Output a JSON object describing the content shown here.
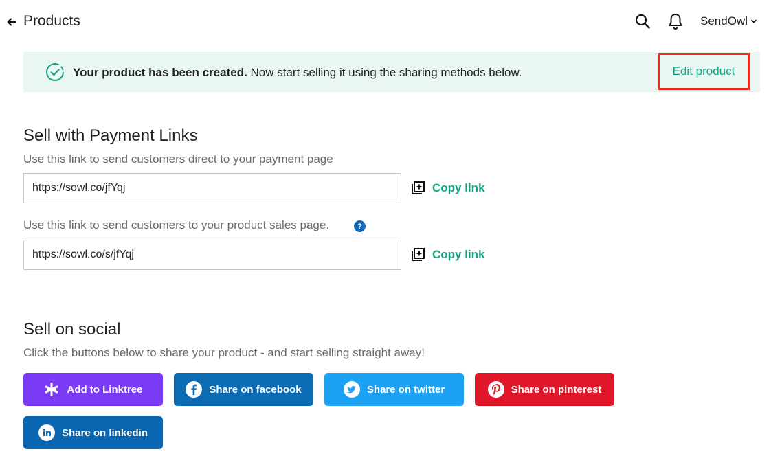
{
  "header": {
    "title": "Products",
    "account_name": "SendOwl"
  },
  "banner": {
    "bold_text": "Your product has been created.",
    "text": " Now start selling it using the sharing methods below.",
    "edit_label": "Edit product"
  },
  "payment_links": {
    "heading": "Sell with Payment Links",
    "direct_description": "Use this link to send customers direct to your payment page",
    "direct_url": "https://sowl.co/jfYqj",
    "sales_description": "Use this link to send customers to your product sales page.",
    "sales_url": "https://sowl.co/s/jfYqj",
    "copy_label": "Copy link",
    "help_glyph": "?"
  },
  "social": {
    "heading": "Sell on social",
    "description": "Click the buttons below to share your product - and start selling straight away!",
    "buttons": [
      {
        "label": "Add to Linktree",
        "icon": "linktree-icon",
        "color": "#7b3bf5"
      },
      {
        "label": "Share on facebook",
        "icon": "facebook-icon",
        "color": "#0b6bb3"
      },
      {
        "label": "Share on twitter",
        "icon": "twitter-icon",
        "color": "#1da1f2"
      },
      {
        "label": "Share on pinterest",
        "icon": "pinterest-icon",
        "color": "#e0162b"
      },
      {
        "label": "Share on linkedin",
        "icon": "linkedin-icon",
        "color": "#0a66b0"
      }
    ]
  },
  "colors": {
    "accent_green": "#16a383",
    "banner_bg": "#e9f6f2",
    "highlight_red": "#e82a1f",
    "help_blue": "#1168b8"
  }
}
